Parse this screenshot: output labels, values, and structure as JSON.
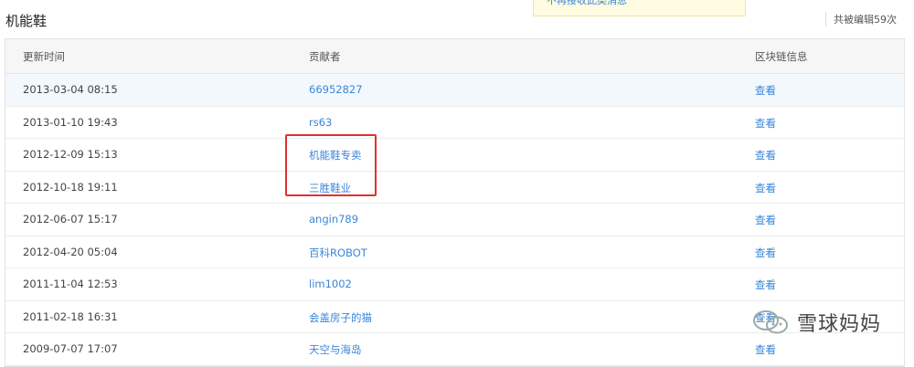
{
  "page": {
    "title": "机能鞋",
    "notice_text": "不再接收此类消息",
    "edit_count": "共被编辑59次"
  },
  "table": {
    "headers": [
      "更新时间",
      "贡献者",
      "区块链信息"
    ],
    "rows": [
      {
        "time": "2013-03-04 08:15",
        "user": "66952827",
        "action": "查看"
      },
      {
        "time": "2013-01-10 19:43",
        "user": "rs63",
        "action": "查看"
      },
      {
        "time": "2012-12-09 15:13",
        "user": "机能鞋专卖",
        "action": "查看"
      },
      {
        "time": "2012-10-18 19:11",
        "user": "三胜鞋业",
        "action": "查看"
      },
      {
        "time": "2012-06-07 15:17",
        "user": "angin789",
        "action": "查看"
      },
      {
        "time": "2012-04-20 05:04",
        "user": "百科ROBOT",
        "action": "查看"
      },
      {
        "time": "2011-11-04 12:53",
        "user": "lim1002",
        "action": "查看"
      },
      {
        "time": "2011-02-18 16:31",
        "user": "会盖房子的猫",
        "action": "查看"
      },
      {
        "time": "2009-07-07 17:07",
        "user": "天空与海岛",
        "action": "查看"
      }
    ]
  },
  "watermark": {
    "text": "雪球妈妈",
    "icon": "wechat-icon"
  },
  "colors": {
    "link": "#3a86d8",
    "highlight_border": "#e0312e",
    "notice_bg": "#fffbe0"
  }
}
